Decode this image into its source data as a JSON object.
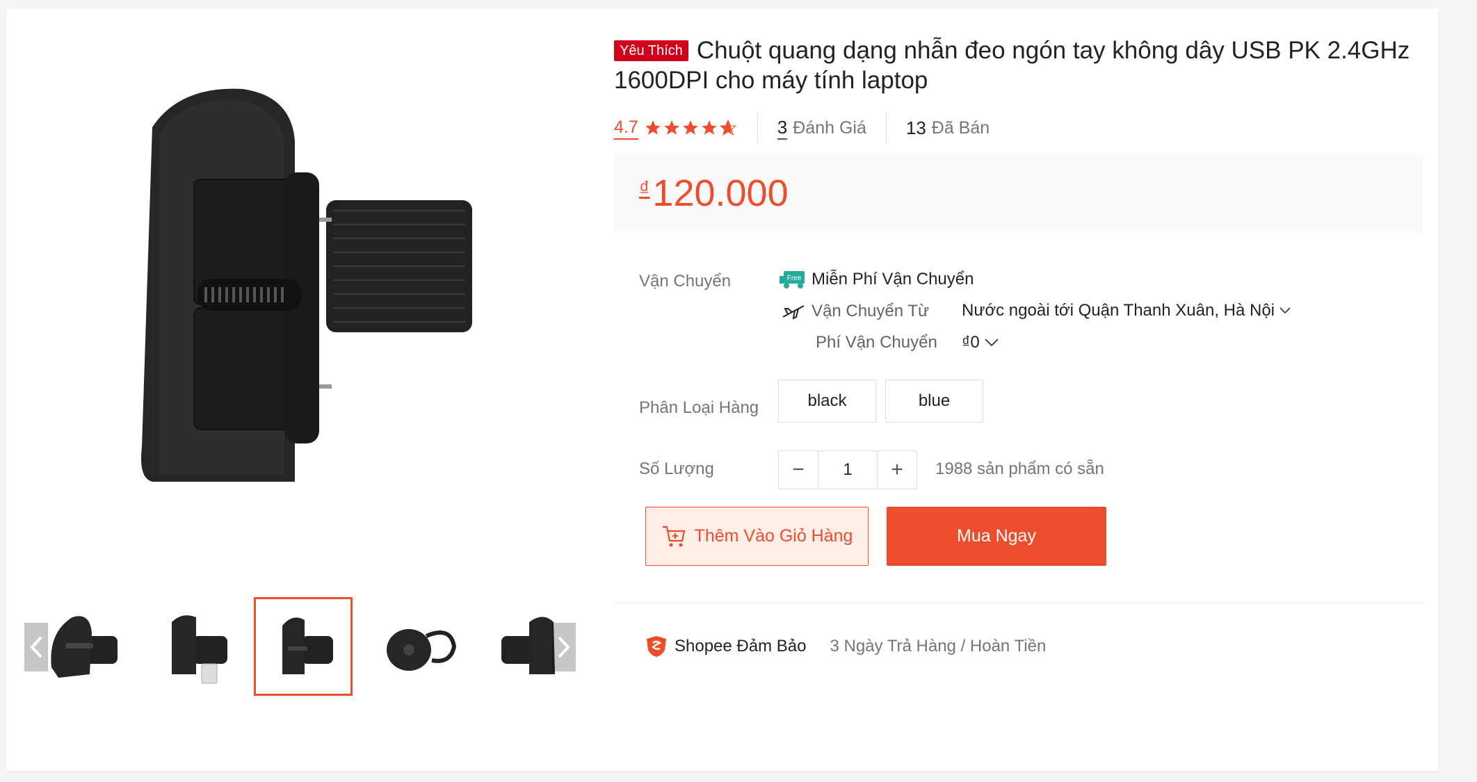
{
  "product": {
    "favorite_badge": "Yêu Thích",
    "title": "Chuột quang dạng nhẫn đeo ngón tay không dây USB PK 2.4GHz 1600DPI cho máy tính laptop",
    "rating": "4.7",
    "rating_value": 4.7,
    "reviews_count": "3",
    "reviews_label": "Đánh Giá",
    "sold_count": "13",
    "sold_label": "Đã Bán",
    "price_currency": "₫",
    "price": "120.000"
  },
  "shipping": {
    "label": "Vận Chuyển",
    "free_badge": "Free",
    "free_text": "Miễn Phí Vận Chuyển",
    "from_label": "Vận Chuyển Từ",
    "from_value": "Nước ngoài tới Quận Thanh Xuân, Hà Nội",
    "fee_label": "Phí Vận Chuyển",
    "fee_value": "₫0"
  },
  "variants": {
    "label": "Phân Loại Hàng",
    "options": [
      "black",
      "blue"
    ]
  },
  "quantity": {
    "label": "Số Lượng",
    "value": "1",
    "minus": "−",
    "plus": "+",
    "stock_text": "1988 sản phẩm có sẵn"
  },
  "actions": {
    "add_to_cart": "Thêm Vào Giỏ Hàng",
    "buy_now": "Mua Ngay"
  },
  "guarantee": {
    "title": "Shopee Đảm Bảo",
    "text": "3 Ngày Trả Hàng / Hoàn Tiền"
  },
  "gallery": {
    "thumb_count": 5,
    "active_thumb_index": 2
  },
  "colors": {
    "accent": "#ee4d2d",
    "favorite_badge": "#d0011b",
    "free_ship": "#26aa99"
  }
}
